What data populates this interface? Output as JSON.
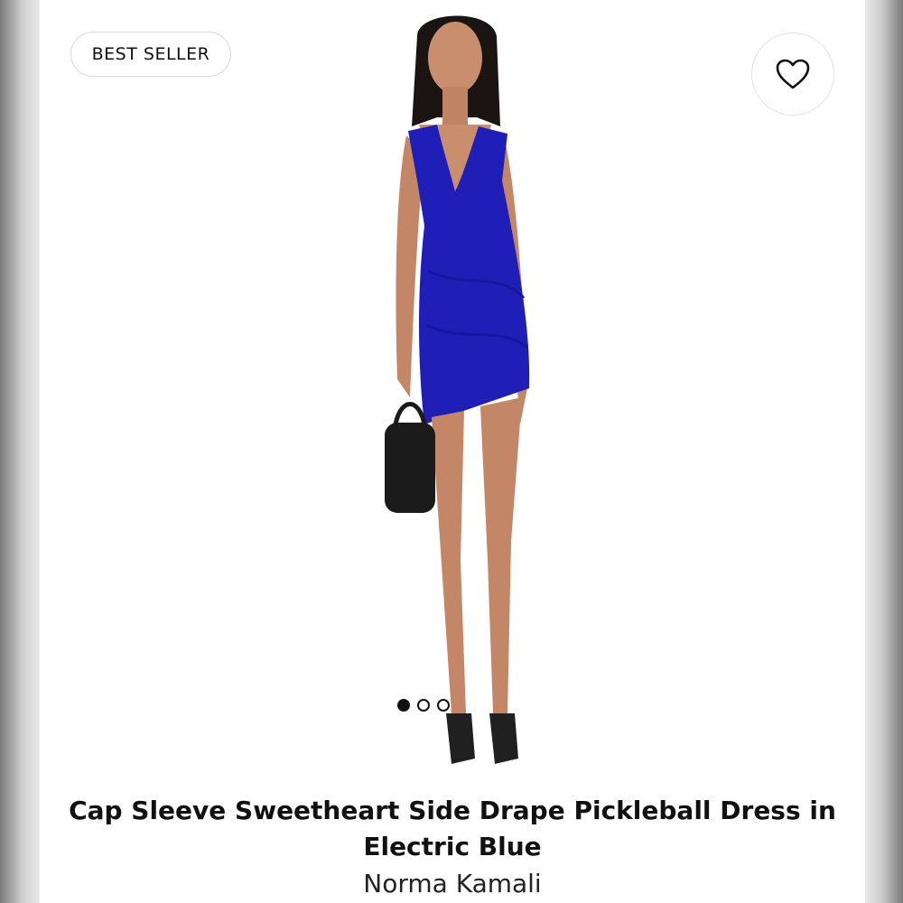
{
  "badge": {
    "label": "BEST SELLER"
  },
  "favorite": {
    "icon": "heart-outline-icon"
  },
  "gallery": {
    "image_count": 3,
    "active_index": 0,
    "dress_color": "#1f1fb8"
  },
  "product": {
    "title": "Cap Sleeve Sweetheart Side Drape Pickleball Dress in Electric Blue",
    "brand": "Norma Kamali"
  }
}
